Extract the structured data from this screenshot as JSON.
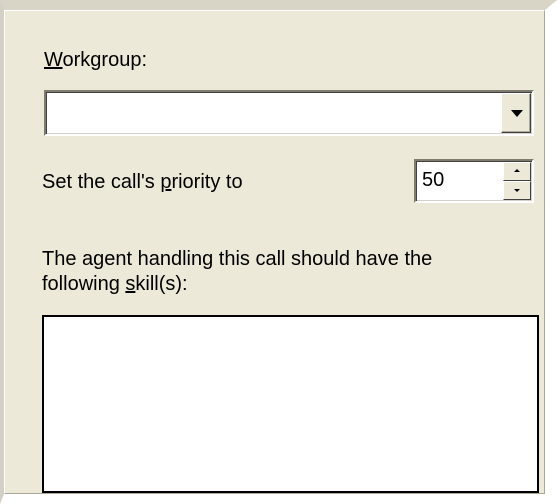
{
  "workgroup": {
    "label_accel": "W",
    "label_rest": "orkgroup:",
    "value": "",
    "dropdown_icon": "chevron-down-icon"
  },
  "priority": {
    "label_before": "Set the call's ",
    "label_accel": "p",
    "label_after": "riority to",
    "value": "50",
    "up_icon": "spin-up-icon",
    "down_icon": "spin-down-icon"
  },
  "skills": {
    "label_line1": "The agent handling this call should have the",
    "label_line2_before": "following ",
    "label_line2_accel": "s",
    "label_line2_after": "kill(s):",
    "items": []
  },
  "colors": {
    "panel_bg": "#ece9d8",
    "field_bg": "#ffffff"
  }
}
